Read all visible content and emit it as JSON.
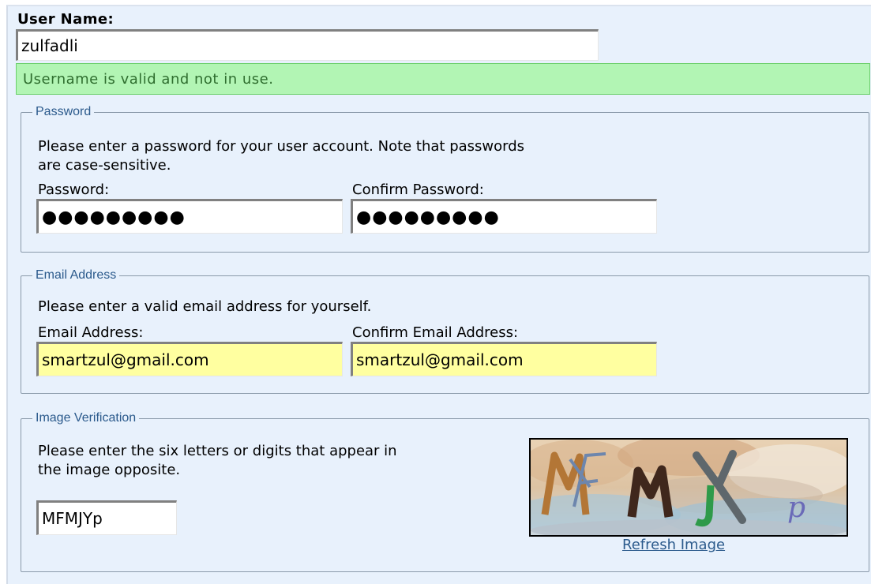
{
  "username": {
    "label": "User Name:",
    "value": "zulfadli",
    "status": "Username is valid and not in use."
  },
  "password_section": {
    "legend": "Password",
    "description_line1": "Please enter a password for your user account. Note that passwords",
    "description_line2": "are case-sensitive.",
    "password_label": "Password:",
    "password_value": "●●●●●●●●●",
    "confirm_label": "Confirm Password:",
    "confirm_value": "●●●●●●●●●"
  },
  "email_section": {
    "legend": "Email Address",
    "description": "Please enter a valid email address for yourself.",
    "email_label": "Email Address:",
    "email_value": "smartzul@gmail.com",
    "confirm_label": "Confirm Email Address:",
    "confirm_value": "smartzul@gmail.com"
  },
  "verification_section": {
    "legend": "Image Verification",
    "description_line1": "Please enter the six letters or digits that appear in",
    "description_line2": "the image opposite.",
    "code_value": "MFMJYp",
    "captcha_image": "captcha-image",
    "refresh_link": "Refresh Image"
  },
  "colors": {
    "panel_bg": "#e8f1fc",
    "valid_bg": "#b2f5b4",
    "valid_text": "#2f6e2f",
    "email_field_bg": "#ffffa0",
    "legend_text": "#2b5a8c",
    "link": "#2b5a8c"
  }
}
